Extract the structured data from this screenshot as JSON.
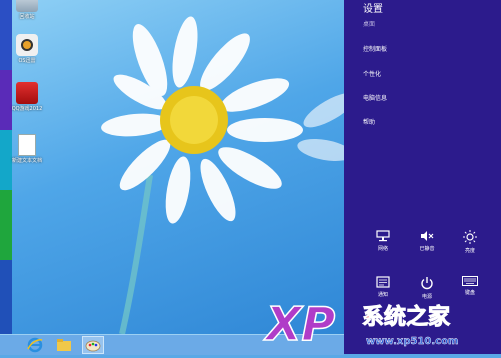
{
  "desktop": {
    "icons": [
      {
        "label": "回收站",
        "icon": "recycle-bin-icon"
      },
      {
        "label": "OS迅雷",
        "icon": "download-app-icon"
      },
      {
        "label": "QQ游戏2012",
        "icon": "game-app-icon"
      },
      {
        "label": "新建文本文档",
        "icon": "text-document-icon"
      }
    ]
  },
  "taskbar": {
    "items": [
      {
        "icon": "internet-explorer-icon"
      },
      {
        "icon": "file-explorer-icon"
      },
      {
        "icon": "paint-icon"
      }
    ]
  },
  "charms": {
    "title": "设置",
    "context": "桌面",
    "links": [
      "控制面板",
      "个性化",
      "电脑信息",
      "帮助"
    ],
    "quick_settings": [
      {
        "label": "网络",
        "icon": "network-icon"
      },
      {
        "label": "已静音",
        "icon": "volume-muted-icon"
      },
      {
        "label": "亮度",
        "icon": "brightness-icon"
      },
      {
        "label": "通知",
        "icon": "notifications-icon"
      },
      {
        "label": "电源",
        "icon": "power-icon"
      },
      {
        "label": "键盘",
        "icon": "keyboard-icon"
      }
    ],
    "accent": "#2c1b8c"
  },
  "watermark": {
    "brand": "XP",
    "site_name": "系统之家",
    "url": "www.xp510.com"
  }
}
